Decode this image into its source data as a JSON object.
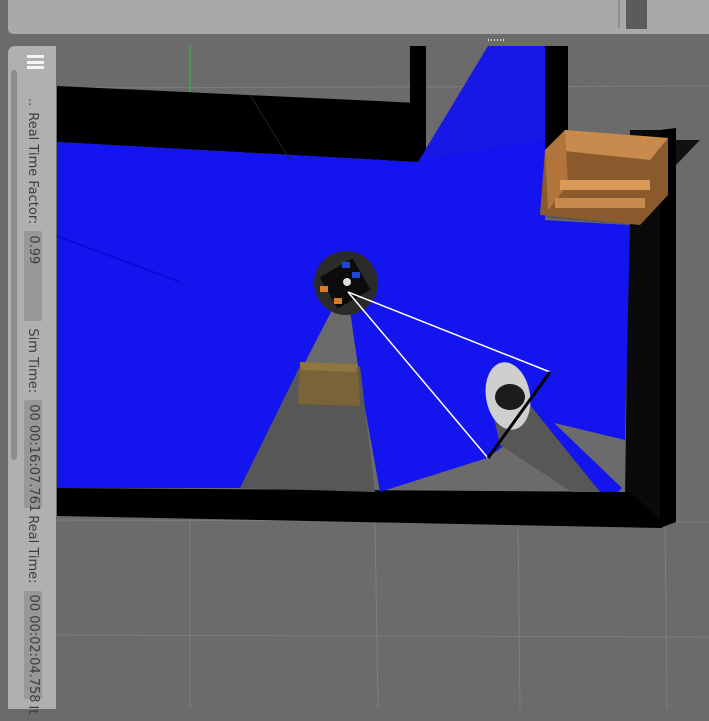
{
  "toolbar": {},
  "panel": {
    "menu_icon": "hamburger-menu-icon",
    "dots": "..",
    "real_time_factor": {
      "label": "Real Time Factor:",
      "value": "0.99"
    },
    "sim_time": {
      "label": "Sim Time:",
      "value": "00 00:16:07.761"
    },
    "real_time": {
      "label": "Real Time:",
      "value": "00 00:02:04.758"
    },
    "iterations_label": "It"
  },
  "scene": {
    "laser_color": "#1414ee",
    "wall_color": "#000000",
    "ground_color": "#6b6b6b",
    "grid_color": "#808080",
    "box_color": "#7a6336",
    "cabinet_color": "#b8763e"
  }
}
